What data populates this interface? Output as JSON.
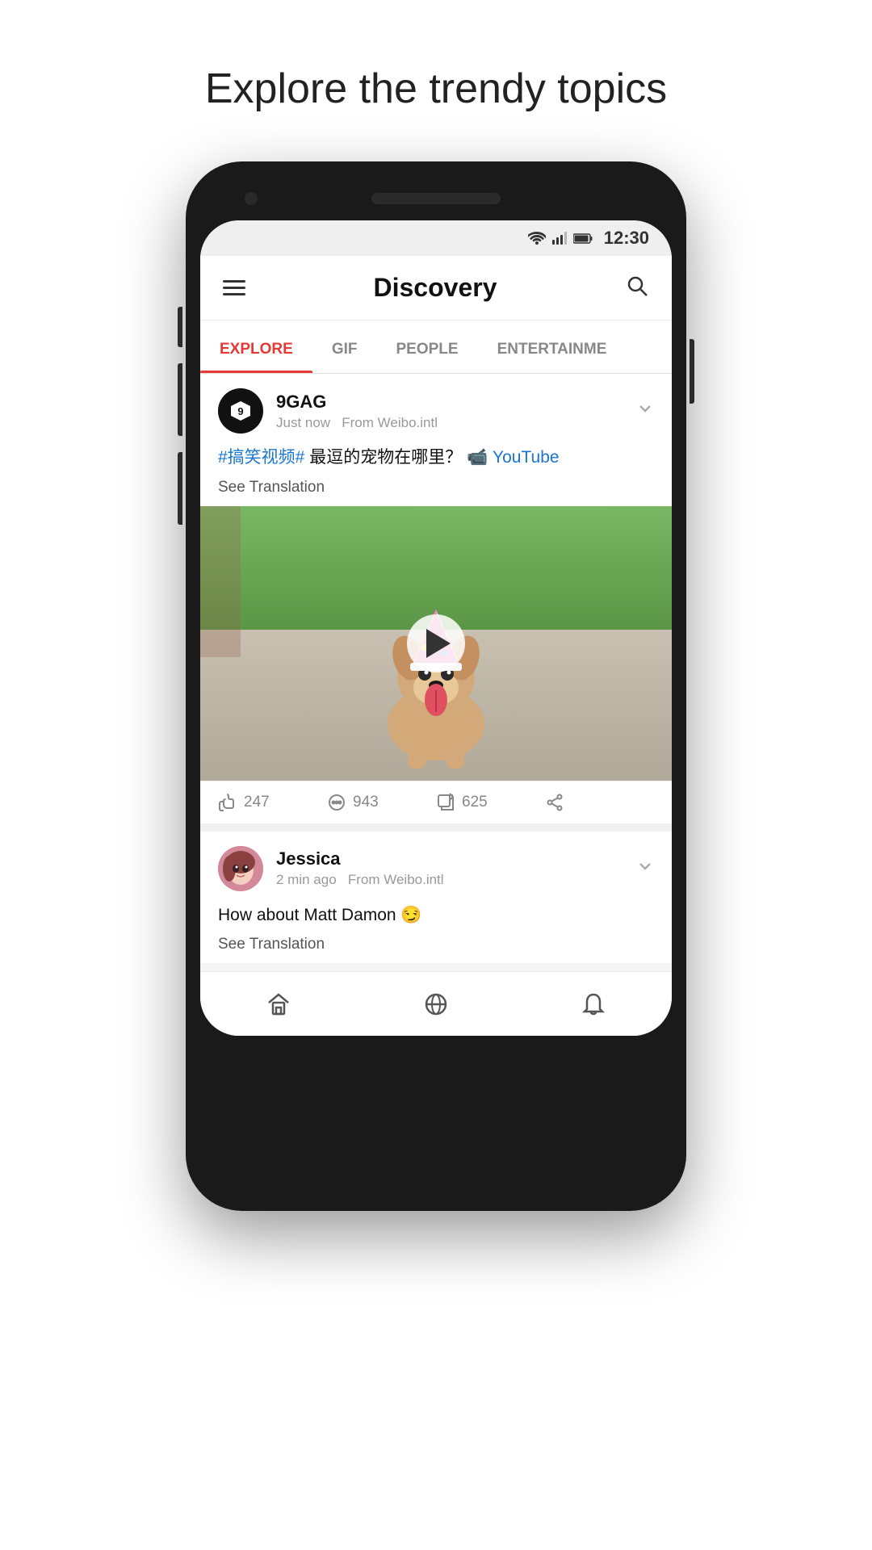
{
  "page": {
    "heading": "Explore the trendy topics"
  },
  "status_bar": {
    "time": "12:30"
  },
  "app_header": {
    "title": "Discovery",
    "search_label": "Search"
  },
  "tabs": [
    {
      "id": "explore",
      "label": "EXPLORE",
      "active": true
    },
    {
      "id": "gif",
      "label": "GIF",
      "active": false
    },
    {
      "id": "people",
      "label": "PEOPLE",
      "active": false
    },
    {
      "id": "entertainment",
      "label": "ENTERTAINME",
      "active": false
    }
  ],
  "posts": [
    {
      "id": "post1",
      "user": "9GAG",
      "timestamp": "Just now",
      "source": "From Weibo.intl",
      "text_parts": [
        "#搞笑视频#",
        " 最逗的宠物在哪里？ ",
        "📹 YouTube"
      ],
      "hashtag": "#搞笑视频#",
      "main_text": "最逗的宠物在哪里？",
      "link_icon": "📹",
      "link_text": "YouTube",
      "see_translation": "See Translation",
      "likes": "247",
      "comments": "943",
      "shares": "625"
    },
    {
      "id": "post2",
      "user": "Jessica",
      "timestamp": "2 min ago",
      "source": "From Weibo.intl",
      "post_text": "How about Matt Damon 😏",
      "see_translation": "See Translation"
    }
  ],
  "bottom_nav": {
    "home_label": "Home",
    "discover_label": "Discover",
    "notifications_label": "Notifications"
  },
  "icons": {
    "menu": "☰",
    "search": "🔍",
    "chevron_down": "⌄",
    "play": "▶",
    "like": "👍",
    "comment": "💬",
    "repost": "↗",
    "share": "⋯",
    "home": "⌂",
    "discover": "◎",
    "bell": "🔔"
  },
  "colors": {
    "active_tab": "#e53935",
    "link": "#1976d2",
    "text_primary": "#111111",
    "text_secondary": "#888888",
    "accent_red": "#e53935"
  }
}
